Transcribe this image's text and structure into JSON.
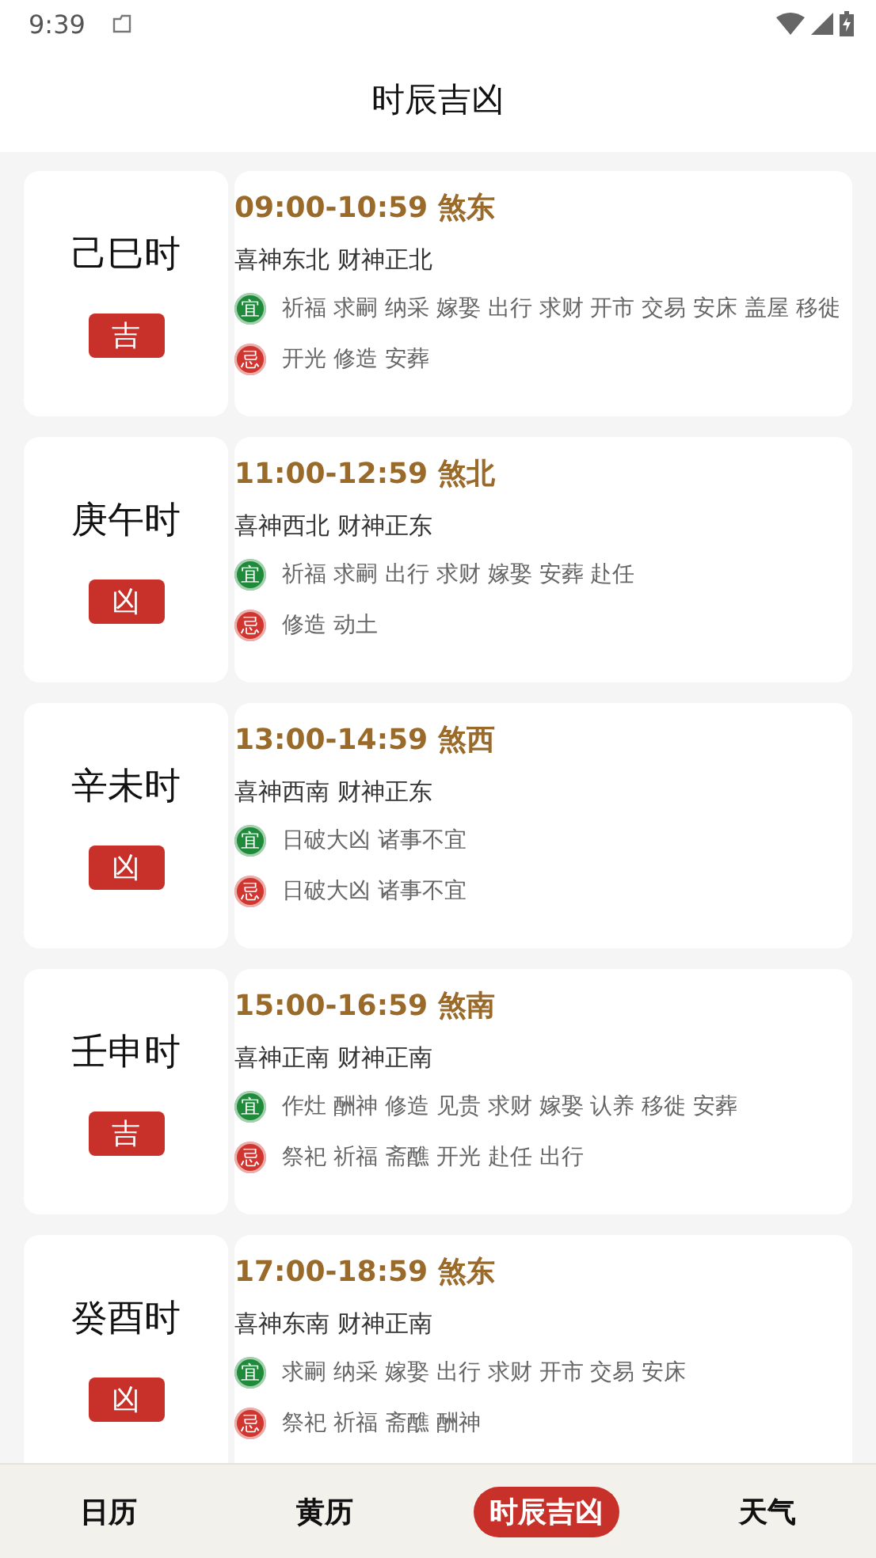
{
  "status_bar": {
    "time": "9:39"
  },
  "header": {
    "title": "时辰吉凶"
  },
  "hours": [
    {
      "name": "己巳时",
      "luck": "吉",
      "time": "09:00-10:59 煞东",
      "gods": "喜神东北 财神正北",
      "rows": [
        {
          "kind": "yi",
          "badge": "宜",
          "text": "祈福 求嗣 纳采 嫁娶 出行 求财 开市 交易 安床 盖屋 移徙"
        },
        {
          "kind": "ji",
          "badge": "忌",
          "text": "开光 修造 安葬"
        }
      ]
    },
    {
      "name": "庚午时",
      "luck": "凶",
      "time": "11:00-12:59 煞北",
      "gods": "喜神西北 财神正东",
      "rows": [
        {
          "kind": "yi",
          "badge": "宜",
          "text": "祈福 求嗣 出行 求财 嫁娶 安葬 赴任"
        },
        {
          "kind": "ji",
          "badge": "忌",
          "text": "修造 动土"
        }
      ]
    },
    {
      "name": "辛未时",
      "luck": "凶",
      "time": "13:00-14:59 煞西",
      "gods": "喜神西南 财神正东",
      "rows": [
        {
          "kind": "yi",
          "badge": "宜",
          "text": "日破大凶 诸事不宜"
        },
        {
          "kind": "ji",
          "badge": "忌",
          "text": "日破大凶 诸事不宜"
        }
      ]
    },
    {
      "name": "壬申时",
      "luck": "吉",
      "time": "15:00-16:59 煞南",
      "gods": "喜神正南 财神正南",
      "rows": [
        {
          "kind": "yi",
          "badge": "宜",
          "text": "作灶 酬神 修造 见贵 求财 嫁娶 认养 移徙 安葬"
        },
        {
          "kind": "ji",
          "badge": "忌",
          "text": "祭祀 祈福 斋醮 开光 赴任 出行"
        }
      ]
    },
    {
      "name": "癸酉时",
      "luck": "凶",
      "time": "17:00-18:59 煞东",
      "gods": "喜神东南 财神正南",
      "rows": [
        {
          "kind": "yi",
          "badge": "宜",
          "text": "求嗣 纳采 嫁娶 出行 求财 开市 交易 安床"
        },
        {
          "kind": "ji",
          "badge": "忌",
          "text": "祭祀 祈福 斋醮 酬神"
        }
      ]
    }
  ],
  "nav": [
    {
      "label": "日历",
      "selected": false
    },
    {
      "label": "黄历",
      "selected": false
    },
    {
      "label": "时辰吉凶",
      "selected": true
    },
    {
      "label": "天气",
      "selected": false
    }
  ]
}
